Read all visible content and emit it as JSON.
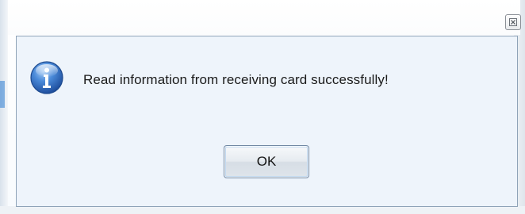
{
  "dialog": {
    "close_icon": "close-icon",
    "icon": "info-icon",
    "message": "Read information from receiving card successfully!",
    "ok_label": "OK"
  },
  "colors": {
    "dialog_background": "#eef4fb",
    "dialog_border": "#8fa3b8",
    "info_icon_blue": "#2f6fc8"
  }
}
